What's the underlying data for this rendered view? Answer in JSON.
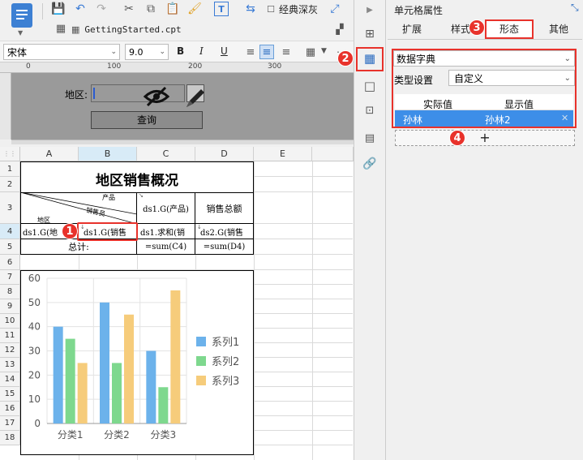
{
  "toolbar": {
    "theme_label": "经典深灰"
  },
  "doc_tab": {
    "title": "GettingStarted.cpt"
  },
  "format": {
    "font_name": "宋体",
    "font_size": "9.0",
    "bold": "B",
    "italic": "I",
    "underline": "U"
  },
  "ruler": {
    "mark_0": "0",
    "mark_100": "100",
    "mark_200": "200",
    "mark_300": "300"
  },
  "param_panel": {
    "region_label": "地区:",
    "query_button": "查询"
  },
  "grid": {
    "columns": [
      "A",
      "B",
      "C",
      "D",
      "E"
    ],
    "rows": [
      "1",
      "2",
      "3",
      "4",
      "5",
      "6",
      "7",
      "8",
      "9",
      "10",
      "11",
      "12",
      "13",
      "14",
      "15",
      "16",
      "17",
      "18"
    ]
  },
  "report": {
    "title": "地区销售概况",
    "header_product": "产品",
    "header_salesperson": "销售员",
    "header_region": "地区",
    "header_c3": "ds1.G(产品)",
    "header_d3": "销售总额",
    "a4": "ds1.G(地",
    "b4": "ds1.G(销售",
    "c4": "ds1.求和(销",
    "d4": "ds2.G(销售",
    "total_label": "总计:",
    "c5": "=sum(C4)",
    "d5": "=sum(D4)"
  },
  "chart_data": {
    "type": "bar",
    "categories": [
      "分类1",
      "分类2",
      "分类3"
    ],
    "series": [
      {
        "name": "系列1",
        "values": [
          40,
          50,
          30
        ],
        "color": "#6cb2eb"
      },
      {
        "name": "系列2",
        "values": [
          35,
          25,
          15
        ],
        "color": "#7ed88e"
      },
      {
        "name": "系列3",
        "values": [
          25,
          45,
          55
        ],
        "color": "#f6cc7b"
      }
    ],
    "ylim": [
      0,
      60
    ],
    "yticks": [
      "0",
      "10",
      "20",
      "30",
      "40",
      "50",
      "60"
    ],
    "grid": true,
    "legend": "right"
  },
  "props": {
    "panel_title": "单元格属性",
    "tabs": [
      "扩展",
      "样式",
      "形态",
      "其他"
    ],
    "active_tab": "形态",
    "form_type": "数据字典",
    "type_setting_label": "类型设置",
    "type_setting_value": "自定义",
    "col_actual": "实际值",
    "col_display": "显示值",
    "row_actual": "孙林",
    "row_display": "孙林2",
    "add_symbol": "+"
  },
  "badges": {
    "b1": "1",
    "b2": "2",
    "b3": "3",
    "b4": "4"
  }
}
